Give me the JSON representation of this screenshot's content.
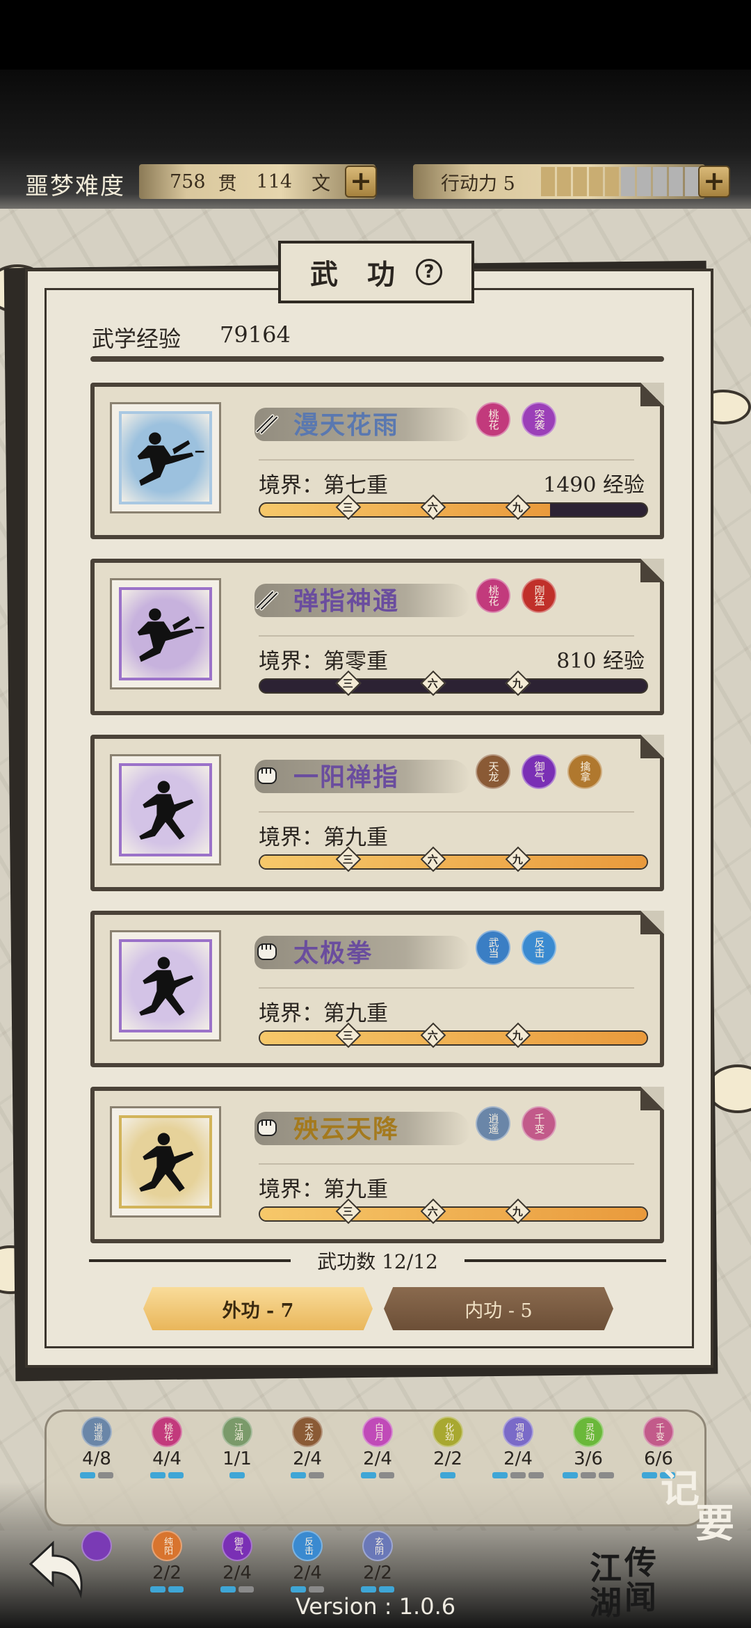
{
  "header": {
    "difficulty": "噩梦难度",
    "money": {
      "guan": "758",
      "guan_unit": "贯",
      "wen": "114",
      "wen_unit": "文"
    },
    "action_label": "行动力 5",
    "action_filled": 5,
    "action_total": 10,
    "plus_label": "+"
  },
  "panel": {
    "title": "武 功",
    "help_label": "?",
    "exp_label": "武学经验",
    "exp_value": "79164"
  },
  "skills": [
    {
      "name": "漫天花雨",
      "name_color": "#5a78b0",
      "type_icon": "dart-icon",
      "portrait_bg": "#9cc1de",
      "portrait_border": "#a9c8e2",
      "pose": "kick",
      "tags": [
        {
          "text": "桃花",
          "color": "#c23a7c"
        },
        {
          "text": "突袭",
          "color": "#9b3fb8"
        }
      ],
      "realm": "境界：第七重",
      "exp": "1490 经验",
      "progress": 0.75
    },
    {
      "name": "弹指神通",
      "name_color": "#6a4d9e",
      "type_icon": "dart-icon",
      "portrait_bg": "#c7b2dd",
      "portrait_border": "#9b72c9",
      "pose": "kick",
      "tags": [
        {
          "text": "桃花",
          "color": "#c23a7c"
        },
        {
          "text": "刚猛",
          "color": "#c0302a"
        }
      ],
      "realm": "境界：第零重",
      "exp": "810 经验",
      "progress": 0.0
    },
    {
      "name": "一阳禅指",
      "name_color": "#6a4d9e",
      "type_icon": "fist-icon",
      "portrait_bg": "#d3c3e6",
      "portrait_border": "#9b72c9",
      "pose": "stance",
      "tags": [
        {
          "text": "天龙",
          "color": "#8a5a35"
        },
        {
          "text": "御气",
          "color": "#7a2fb5"
        },
        {
          "text": "擒拿",
          "color": "#b0782e"
        }
      ],
      "realm": "境界：第九重",
      "exp": "",
      "progress": 1.0
    },
    {
      "name": "太极拳",
      "name_color": "#6a4d9e",
      "type_icon": "fist-icon",
      "portrait_bg": "#d3c3e6",
      "portrait_border": "#9b72c9",
      "pose": "stance",
      "tags": [
        {
          "text": "武当",
          "color": "#3a7ec4"
        },
        {
          "text": "反击",
          "color": "#3a8ad0"
        }
      ],
      "realm": "境界：第九重",
      "exp": "",
      "progress": 1.0
    },
    {
      "name": "殃云天降",
      "name_color": "#a47a1e",
      "type_icon": "fist-icon",
      "portrait_bg": "#e6d29a",
      "portrait_border": "#d2b45a",
      "pose": "stance",
      "tags": [
        {
          "text": "逍遥",
          "color": "#6a86a8"
        },
        {
          "text": "千变",
          "color": "#c25a8a"
        }
      ],
      "realm": "境界：第九重",
      "exp": "",
      "progress": 1.0
    }
  ],
  "markers": [
    "三",
    "六",
    "九"
  ],
  "skill_count": "武功数 12/12",
  "tabs": {
    "outer": "外功 - 7",
    "inner": "内功 - 5"
  },
  "schools": [
    {
      "name": "逍遥",
      "color": "#6a86a8",
      "count": "4/8",
      "on": 1,
      "total": 2
    },
    {
      "name": "桃花",
      "color": "#c23a7c",
      "count": "4/4",
      "on": 2,
      "total": 2
    },
    {
      "name": "江湖",
      "color": "#7a9a6a",
      "count": "1/1",
      "on": 1,
      "total": 1
    },
    {
      "name": "天龙",
      "color": "#8a5a35",
      "count": "2/4",
      "on": 1,
      "total": 2
    },
    {
      "name": "白月",
      "color": "#c04ab8",
      "count": "2/4",
      "on": 1,
      "total": 2
    },
    {
      "name": "化劲",
      "color": "#a8a830",
      "count": "2/2",
      "on": 1,
      "total": 1
    },
    {
      "name": "凋息",
      "color": "#7a6ac8",
      "count": "2/4",
      "on": 1,
      "total": 3
    },
    {
      "name": "灵动",
      "color": "#6ab83a",
      "count": "3/6",
      "on": 1,
      "total": 3
    },
    {
      "name": "千变",
      "color": "#c25a8a",
      "count": "6/6",
      "on": 2,
      "total": 2
    },
    {
      "name": "",
      "color": "#7a3ab5",
      "count": "",
      "on": 0,
      "total": 0
    },
    {
      "name": "纯阳",
      "color": "#d8742e",
      "count": "2/2",
      "on": 2,
      "total": 2
    },
    {
      "name": "御气",
      "color": "#7a2fb5",
      "count": "2/4",
      "on": 1,
      "total": 2
    },
    {
      "name": "反击",
      "color": "#3a8ad0",
      "count": "2/4",
      "on": 1,
      "total": 2
    },
    {
      "name": "玄阴",
      "color": "#6a78b8",
      "count": "2/2",
      "on": 2,
      "total": 2
    }
  ],
  "memo_label": {
    "a": "记",
    "b": "要"
  },
  "rumor_label": {
    "a": "江",
    "b": "湖",
    "c": "传",
    "d": "闻"
  },
  "version": "Version : 1.0.6"
}
